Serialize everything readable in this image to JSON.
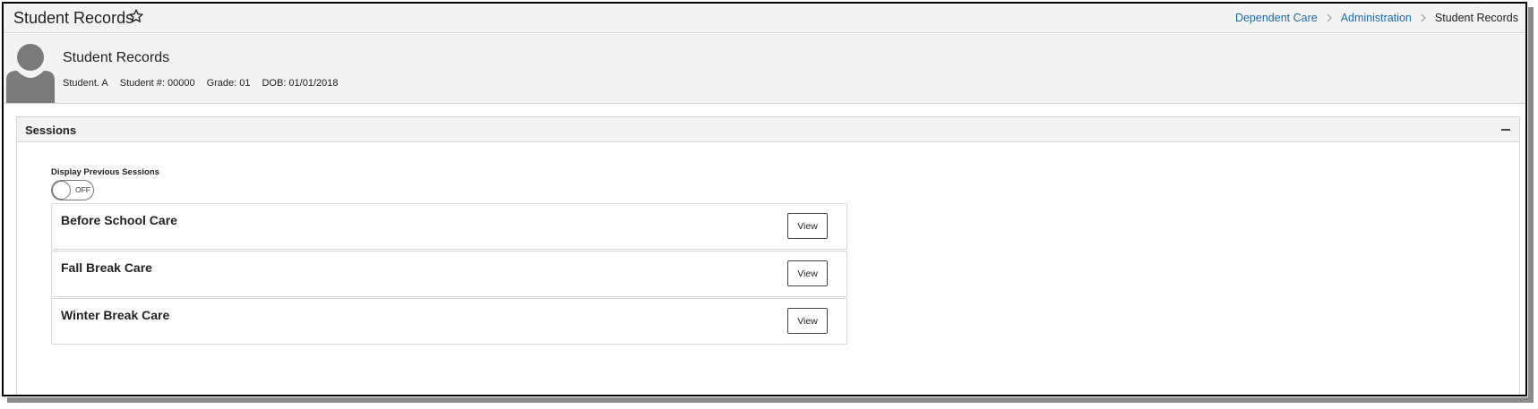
{
  "header": {
    "title": "Student Records",
    "breadcrumb": {
      "items": [
        "Dependent Care",
        "Administration"
      ],
      "current": "Student Records"
    }
  },
  "student": {
    "title": "Student Records",
    "name": "Student. A",
    "student_number": "Student #: 00000",
    "grade": "Grade: 01",
    "dob": "DOB: 01/01/2018"
  },
  "sessions": {
    "title": "Sessions",
    "toggle_label": "Display Previous Sessions",
    "toggle_state": "OFF",
    "items": [
      {
        "title": "Before School Care",
        "button": "View"
      },
      {
        "title": "Fall Break Care",
        "button": "View"
      },
      {
        "title": "Winter Break Care",
        "button": "View"
      }
    ]
  },
  "colors": {
    "link": "#1f6cb0",
    "header_bg": "#f3f3f3",
    "border": "#d6d6d6"
  }
}
